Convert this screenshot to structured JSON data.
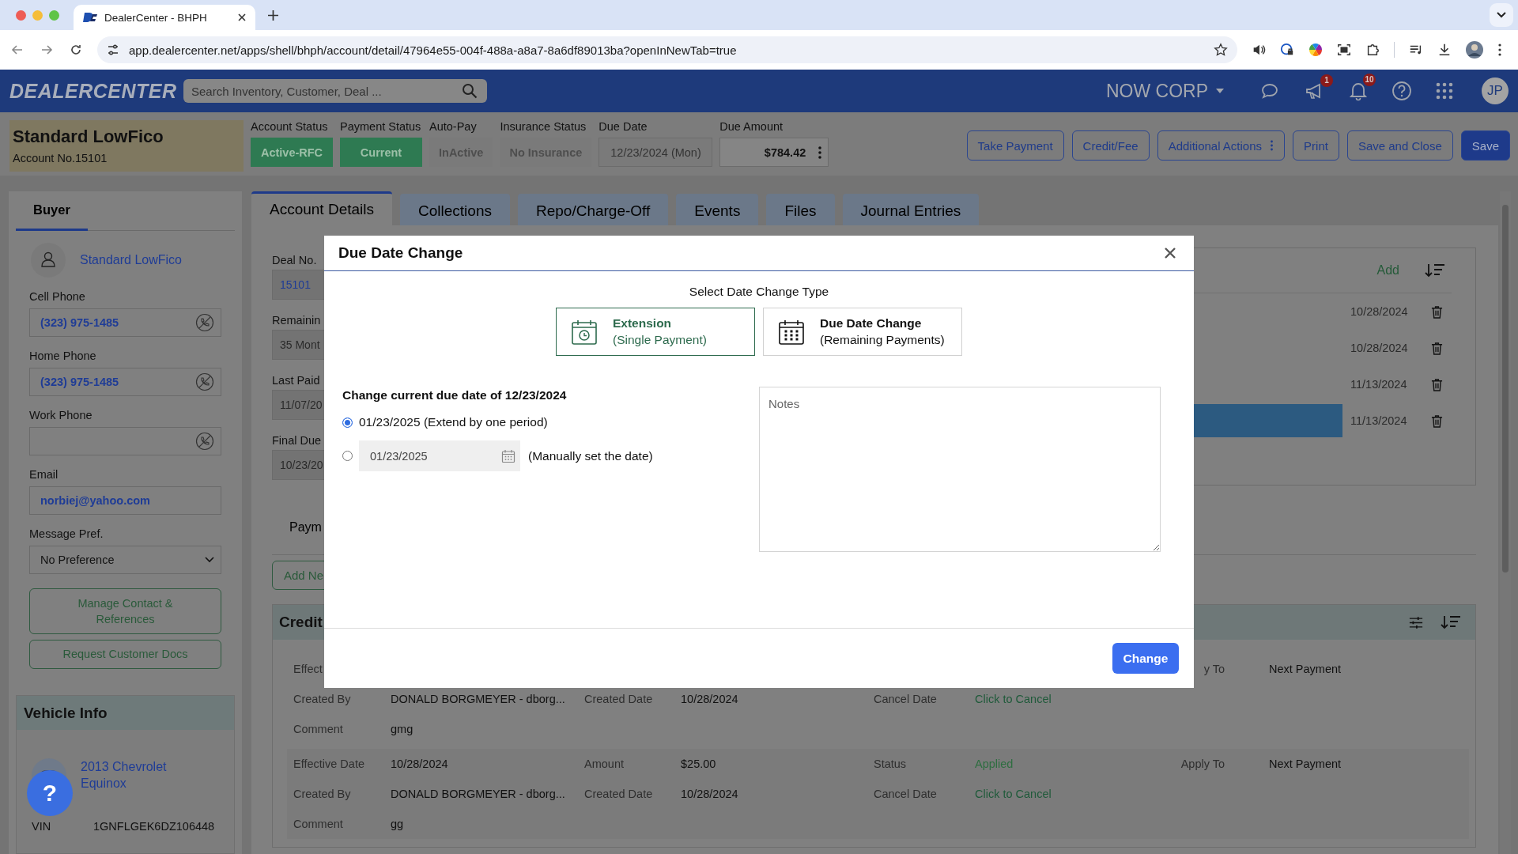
{
  "browser": {
    "tab_title": "DealerCenter - BHPH",
    "url": "app.dealercenter.net/apps/shell/bhph/account/detail/47964e55-004f-488a-a8a7-8a6df89013ba?openInNewTab=true"
  },
  "header": {
    "logo": "DEALERCENTER",
    "search_placeholder": "Search Inventory, Customer, Deal ...",
    "company": "NOW CORP",
    "announcements_badge": "1",
    "notifications_badge": "10",
    "avatar": "JP"
  },
  "account": {
    "name": "Standard LowFico",
    "account_no": "Account No.15101",
    "statuses": [
      {
        "label": "Account Status",
        "value": "Active-RFC",
        "kind": "active"
      },
      {
        "label": "Payment Status",
        "value": "Current",
        "kind": "active"
      },
      {
        "label": "Auto-Pay",
        "value": "InActive",
        "kind": "inactive"
      },
      {
        "label": "Insurance Status",
        "value": "No Insurance",
        "kind": "inactive"
      }
    ],
    "due_date": {
      "label": "Due Date",
      "value": "12/23/2024 (Mon)"
    },
    "due_amount": {
      "label": "Due Amount",
      "value": "$784.42"
    }
  },
  "actions": [
    {
      "label": "Take Payment",
      "kind": "outline"
    },
    {
      "label": "Credit/Fee",
      "kind": "outline"
    },
    {
      "label": "Additional Actions",
      "kind": "menu"
    },
    {
      "label": "Print",
      "kind": "outline"
    },
    {
      "label": "Save and Close",
      "kind": "outline"
    },
    {
      "label": "Save",
      "kind": "primary"
    }
  ],
  "sidebar": {
    "tabs": [
      {
        "label": "Buyer",
        "selected": true
      }
    ],
    "buyer_name": "Standard LowFico",
    "fields": [
      {
        "label": "Cell Phone",
        "value": "(323) 975-1485",
        "kind": "phone"
      },
      {
        "label": "Home Phone",
        "value": "(323) 975-1485",
        "kind": "phone"
      },
      {
        "label": "Work Phone",
        "kind": "phone"
      },
      {
        "label": "Email",
        "value": "norbiej@yahoo.com",
        "kind": "email"
      },
      {
        "label": "Message Pref.",
        "value": "No Preference",
        "kind": "select"
      }
    ],
    "buttons": [
      "Manage Contact & References",
      "Request Customer Docs"
    ],
    "vehicle": {
      "title": "Vehicle Info",
      "name": "2013 Chevrolet Equinox",
      "fields": [
        {
          "label": "VIN",
          "value": "1GNFLGEK6DZ106448"
        }
      ]
    }
  },
  "help_button": "?",
  "tabs": [
    {
      "label": "Account Details",
      "selected": true
    },
    {
      "label": "Collections",
      "selected": false
    },
    {
      "label": "Repo/Charge-Off",
      "selected": false
    },
    {
      "label": "Events",
      "selected": false
    },
    {
      "label": "Files",
      "selected": false
    },
    {
      "label": "Journal Entries",
      "selected": false
    }
  ],
  "account_details": {
    "fields": [
      {
        "label": "Deal No.",
        "value": "15101",
        "kind": "link"
      },
      {
        "label": "Remainin",
        "value": "35 Mont",
        "kind": "text"
      },
      {
        "label": "Last Paid",
        "value": "11/07/20",
        "kind": "text"
      },
      {
        "label": "Final Due",
        "value": "10/23/20",
        "kind": "text"
      }
    ],
    "list": {
      "add": "Add",
      "rows": [
        {
          "date": "10/28/2024",
          "selected": false
        },
        {
          "date": "10/28/2024",
          "selected": false
        },
        {
          "date": "11/13/2024",
          "selected": false
        },
        {
          "date": "11/13/2024",
          "selected": true
        }
      ]
    },
    "sub_tab": "Paym",
    "add_button": "Add Ne",
    "credits": {
      "title": "Credit",
      "rows": [
        {
          "effective_label": "Effect",
          "apply_label": "y To",
          "apply": "Next Payment",
          "created_by_label": "Created By",
          "created_by": "DONALD BORGMEYER - dborg...",
          "created_date_label": "Created Date",
          "created_date": "10/28/2024",
          "cancel_label": "Cancel Date",
          "cancel": "Click to Cancel",
          "comment_label": "Comment",
          "comment": "gmg"
        },
        {
          "effective_label": "Effective Date",
          "effective": "10/28/2024",
          "amount_label": "Amount",
          "amount": "$25.00",
          "status_label": "Status",
          "status": "Applied",
          "apply_label": "Apply To",
          "apply": "Next Payment",
          "created_by_label": "Created By",
          "created_by": "DONALD BORGMEYER - dborg...",
          "created_date_label": "Created Date",
          "created_date": "10/28/2024",
          "cancel_label": "Cancel Date",
          "cancel": "Click to Cancel",
          "comment_label": "Comment",
          "comment": "gg"
        }
      ]
    }
  },
  "modal": {
    "title": "Due Date Change",
    "type_heading": "Select Date Change Type",
    "types": [
      {
        "title": "Extension",
        "subtitle": "(Single Payment)",
        "selected": true,
        "kind": "clock"
      },
      {
        "title": "Due Date Change",
        "subtitle": "(Remaining Payments)",
        "selected": false,
        "kind": "grid"
      }
    ],
    "question": "Change current due date of 12/23/2024",
    "options": [
      {
        "label": "01/23/2025 (Extend by one period)",
        "selected": true,
        "kind": "preset"
      },
      {
        "label": "(Manually set the date)",
        "date_value": "01/23/2025",
        "selected": false,
        "kind": "manual"
      }
    ],
    "notes_placeholder": "Notes",
    "submit": "Change"
  }
}
